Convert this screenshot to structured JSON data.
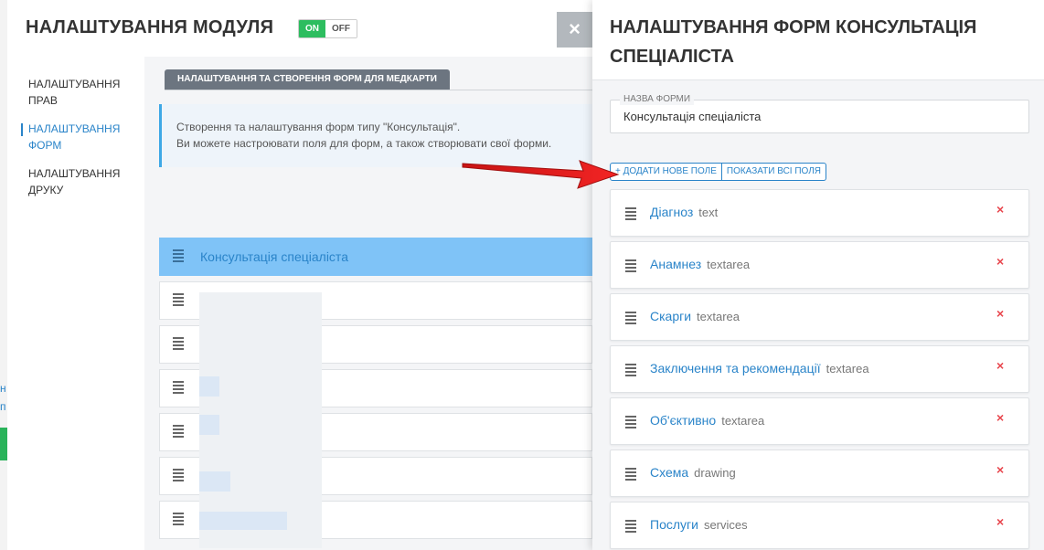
{
  "module": {
    "title": "НАЛАШТУВАННЯ МОДУЛЯ",
    "toggle_on": "ON",
    "toggle_off": "OFF",
    "close_symbol": "×",
    "nav": [
      {
        "label": "НАЛАШТУВАННЯ ПРАВ"
      },
      {
        "label": "НАЛАШТУВАННЯ ФОРМ"
      },
      {
        "label": "НАЛАШТУВАННЯ ДРУКУ"
      }
    ],
    "active_tab": "НАЛАШТУВАННЯ ТА СТВОРЕННЯ ФОРМ ДЛЯ МЕДКАРТИ",
    "info_line1": "Створення та налаштування форм типу \"Консультація\".",
    "info_line2": "Ви можете настроювати поля для форм, а також створювати свої форми.",
    "forms": [
      {
        "label": "Консультація спеціаліста"
      }
    ]
  },
  "drawer": {
    "title": "НАЛАШТУВАННЯ ФОРМ КОНСУЛЬТАЦІЯ СПЕЦІАЛІСТА",
    "form_name_legend": "НАЗВА ФОРМИ",
    "form_name_value": "Консультація спеціаліста",
    "add_field_label": "+ ДОДАТИ НОВЕ ПОЛЕ",
    "show_all_label": "ПОКАЗАТИ ВСІ ПОЛЯ",
    "remove_symbol": "×",
    "fields": [
      {
        "name": "Діагноз",
        "type": "text"
      },
      {
        "name": "Анамнез",
        "type": "textarea"
      },
      {
        "name": "Скарги",
        "type": "textarea"
      },
      {
        "name": "Заключення та рекомендації",
        "type": "textarea"
      },
      {
        "name": "Об'єктивно",
        "type": "textarea"
      },
      {
        "name": "Схема",
        "type": "drawing"
      },
      {
        "name": "Послуги",
        "type": "services"
      }
    ]
  },
  "colors": {
    "accent": "#2a84c9",
    "toggle_on": "#2dbd5f",
    "selected_row": "#7fc3f7",
    "remove": "#e8464d",
    "arrow": "#e01b1b"
  }
}
